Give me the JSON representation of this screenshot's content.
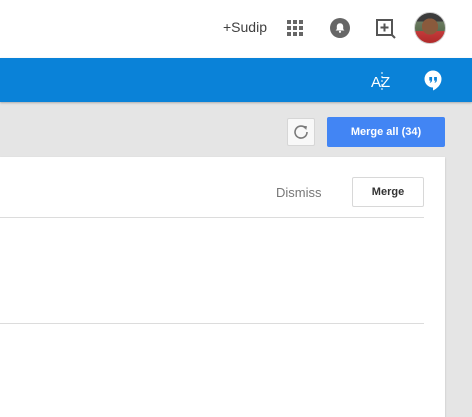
{
  "header": {
    "user_link": "+Sudip",
    "icons": {
      "apps": "apps-grid-icon",
      "notifications": "notifications-bell-icon",
      "share": "add-share-icon",
      "avatar": "user-avatar"
    }
  },
  "toolbar": {
    "sort_icon": "sort-az-icon",
    "sort_label": "AZ",
    "quote_icon": "quote-bubble-icon"
  },
  "actions": {
    "refresh_icon": "refresh-icon",
    "merge_all_label": "Merge all (34)"
  },
  "card": {
    "dismiss_label": "Dismiss",
    "merge_label": "Merge"
  },
  "colors": {
    "brand_blue": "#0a82d8",
    "primary_button": "#4285f4"
  }
}
